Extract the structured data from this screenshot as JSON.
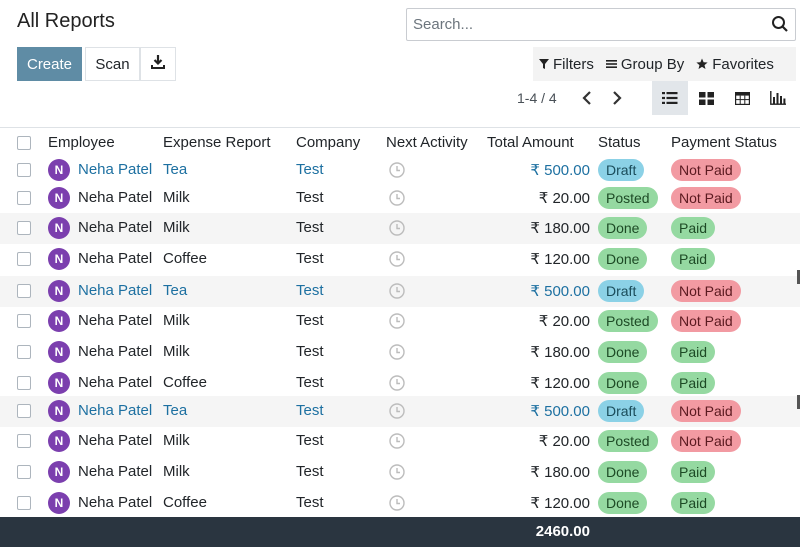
{
  "page": {
    "title": "All Reports"
  },
  "search": {
    "placeholder": "Search..."
  },
  "toolbar": {
    "create_label": "Create",
    "scan_label": "Scan",
    "download_icon": "download-icon"
  },
  "filters": {
    "filters_label": "Filters",
    "groupby_label": "Group By",
    "favorites_label": "Favorites"
  },
  "pager": {
    "text": "1-4 / 4"
  },
  "views": [
    "list",
    "kanban",
    "pivot",
    "graph"
  ],
  "columns": {
    "employee": "Employee",
    "expense_report": "Expense Report",
    "company": "Company",
    "next_activity": "Next Activity",
    "total_amount": "Total Amount",
    "status": "Status",
    "payment_status": "Payment Status"
  },
  "rows": [
    {
      "avatar": "N",
      "employee": "Neha Patel",
      "report": "Tea",
      "company": "Test",
      "amount": "₹ 500.00",
      "status": "Draft",
      "payment": "Not Paid"
    },
    {
      "avatar": "N",
      "employee": "Neha Patel",
      "report": "Milk",
      "company": "Test",
      "amount": "₹ 20.00",
      "status": "Posted",
      "payment": "Not Paid"
    },
    {
      "avatar": "N",
      "employee": "Neha Patel",
      "report": "Milk",
      "company": "Test",
      "amount": "₹ 180.00",
      "status": "Done",
      "payment": "Paid"
    },
    {
      "avatar": "N",
      "employee": "Neha Patel",
      "report": "Coffee",
      "company": "Test",
      "amount": "₹ 120.00",
      "status": "Done",
      "payment": "Paid"
    },
    {
      "avatar": "N",
      "employee": "Neha Patel",
      "report": "Tea",
      "company": "Test",
      "amount": "₹ 500.00",
      "status": "Draft",
      "payment": "Not Paid"
    },
    {
      "avatar": "N",
      "employee": "Neha Patel",
      "report": "Milk",
      "company": "Test",
      "amount": "₹ 20.00",
      "status": "Posted",
      "payment": "Not Paid"
    },
    {
      "avatar": "N",
      "employee": "Neha Patel",
      "report": "Milk",
      "company": "Test",
      "amount": "₹ 180.00",
      "status": "Done",
      "payment": "Paid"
    },
    {
      "avatar": "N",
      "employee": "Neha Patel",
      "report": "Coffee",
      "company": "Test",
      "amount": "₹ 120.00",
      "status": "Done",
      "payment": "Paid"
    },
    {
      "avatar": "N",
      "employee": "Neha Patel",
      "report": "Tea",
      "company": "Test",
      "amount": "₹ 500.00",
      "status": "Draft",
      "payment": "Not Paid"
    },
    {
      "avatar": "N",
      "employee": "Neha Patel",
      "report": "Milk",
      "company": "Test",
      "amount": "₹ 20.00",
      "status": "Posted",
      "payment": "Not Paid"
    },
    {
      "avatar": "N",
      "employee": "Neha Patel",
      "report": "Milk",
      "company": "Test",
      "amount": "₹ 180.00",
      "status": "Done",
      "payment": "Paid"
    },
    {
      "avatar": "N",
      "employee": "Neha Patel",
      "report": "Coffee",
      "company": "Test",
      "amount": "₹ 120.00",
      "status": "Done",
      "payment": "Paid"
    }
  ],
  "footer": {
    "total": "2460.00"
  },
  "colors": {
    "create_button": "#5f8ca5",
    "link": "#1d70a1",
    "avatar": "#7b3fae",
    "footer": "#2a3540"
  }
}
